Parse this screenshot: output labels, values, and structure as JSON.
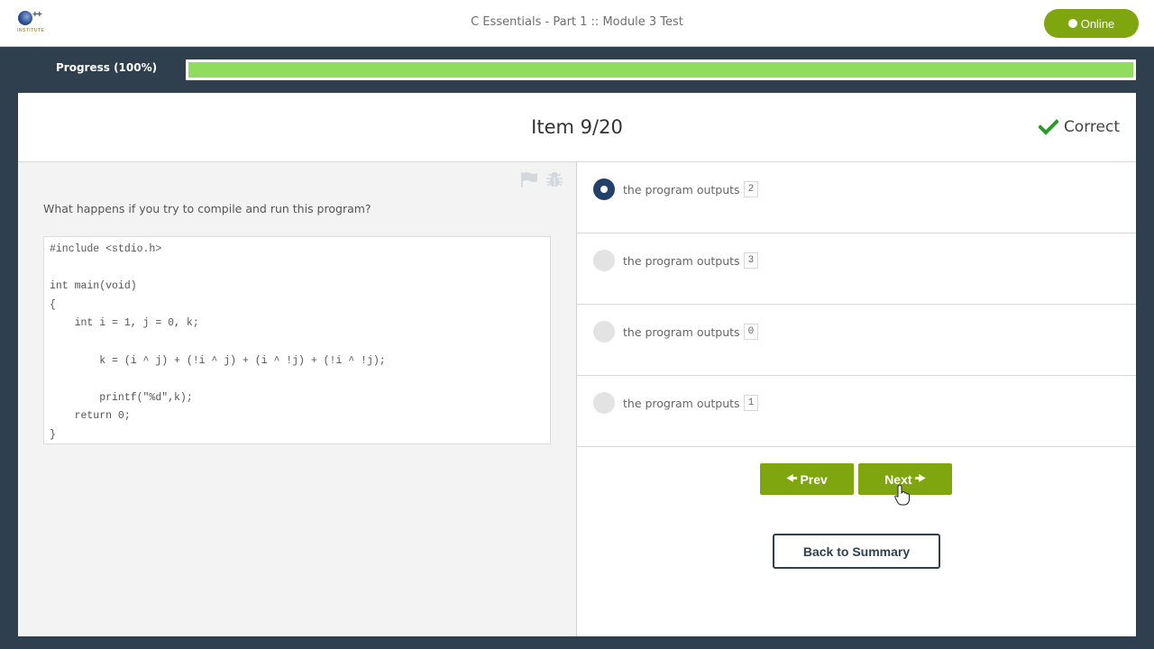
{
  "header": {
    "logo_text": "++",
    "logo_subtext": "INSTITUTE",
    "title": "C Essentials - Part 1 :: Module 3 Test",
    "online_label": "Online"
  },
  "progress": {
    "label": "Progress (100%)",
    "percent": 100,
    "fill_color": "#8fdc5e"
  },
  "item": {
    "title": "Item 9/20",
    "status_label": "Correct",
    "status_icon": "check-icon",
    "status_color": "#2a9a2a"
  },
  "question": {
    "icons": [
      "flag-icon",
      "bug-icon"
    ],
    "text": "What happens if you try to compile and run this program?",
    "code": "#include <stdio.h>\n\nint main(void)\n{\n    int i = 1, j = 0, k;\n\n        k = (i ^ j) + (!i ^ j) + (i ^ !j) + (!i ^ !j);\n\n        printf(\"%d\",k);\n    return 0;\n}"
  },
  "answers": [
    {
      "text": "the program outputs",
      "value": "2",
      "selected": true
    },
    {
      "text": "the program outputs",
      "value": "3",
      "selected": false
    },
    {
      "text": "the program outputs",
      "value": "0",
      "selected": false
    },
    {
      "text": "the program outputs",
      "value": "1",
      "selected": false
    }
  ],
  "navigation": {
    "prev_label": "Prev",
    "next_label": "Next",
    "summary_label": "Back to Summary"
  },
  "colors": {
    "accent_green": "#7fa50f",
    "dark_navy": "#2f3f4e",
    "radio_selected": "#23406b"
  }
}
